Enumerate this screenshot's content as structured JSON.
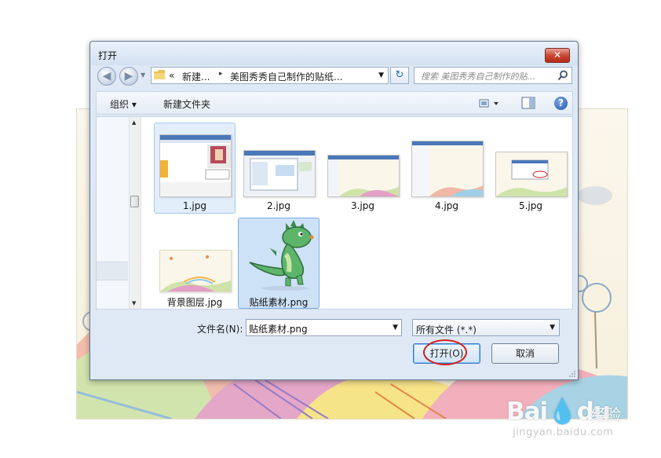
{
  "dialog": {
    "title": "打开",
    "close_label": "✕"
  },
  "address": {
    "raquo": "«",
    "segment1": "新建...",
    "separator": "▸",
    "segment2": "美图秀秀自己制作的贴纸...",
    "dropdown": "▼",
    "refresh": "↻"
  },
  "search": {
    "placeholder": "搜索 美图秀秀自己制作的贴...",
    "icon": "search-icon"
  },
  "toolbar": {
    "organize_label": "组织 ▾",
    "new_folder_label": "新建文件夹",
    "help_label": "?"
  },
  "files": [
    {
      "name": "1.jpg",
      "state": "hover"
    },
    {
      "name": "2.jpg",
      "state": "normal"
    },
    {
      "name": "3.jpg",
      "state": "normal"
    },
    {
      "name": "4.jpg",
      "state": "normal"
    },
    {
      "name": "5.jpg",
      "state": "normal"
    },
    {
      "name": "背景图层.jpg",
      "state": "normal"
    },
    {
      "name": "贴纸素材.png",
      "state": "selected"
    }
  ],
  "bottom": {
    "filename_label": "文件名(N):",
    "filename_value": "贴纸素材.png",
    "filter_value": "所有文件  (*.*)",
    "open_label": "打开(O)",
    "cancel_label": "取消"
  },
  "watermark": {
    "logo": "Bai💧du",
    "jingyan": "经验",
    "url": "jingyan.baidu.com"
  },
  "colors": {
    "dialog_bg": "#dfe9f5",
    "selection": "#cde1f7",
    "annotation_circle": "#d41d1d"
  }
}
